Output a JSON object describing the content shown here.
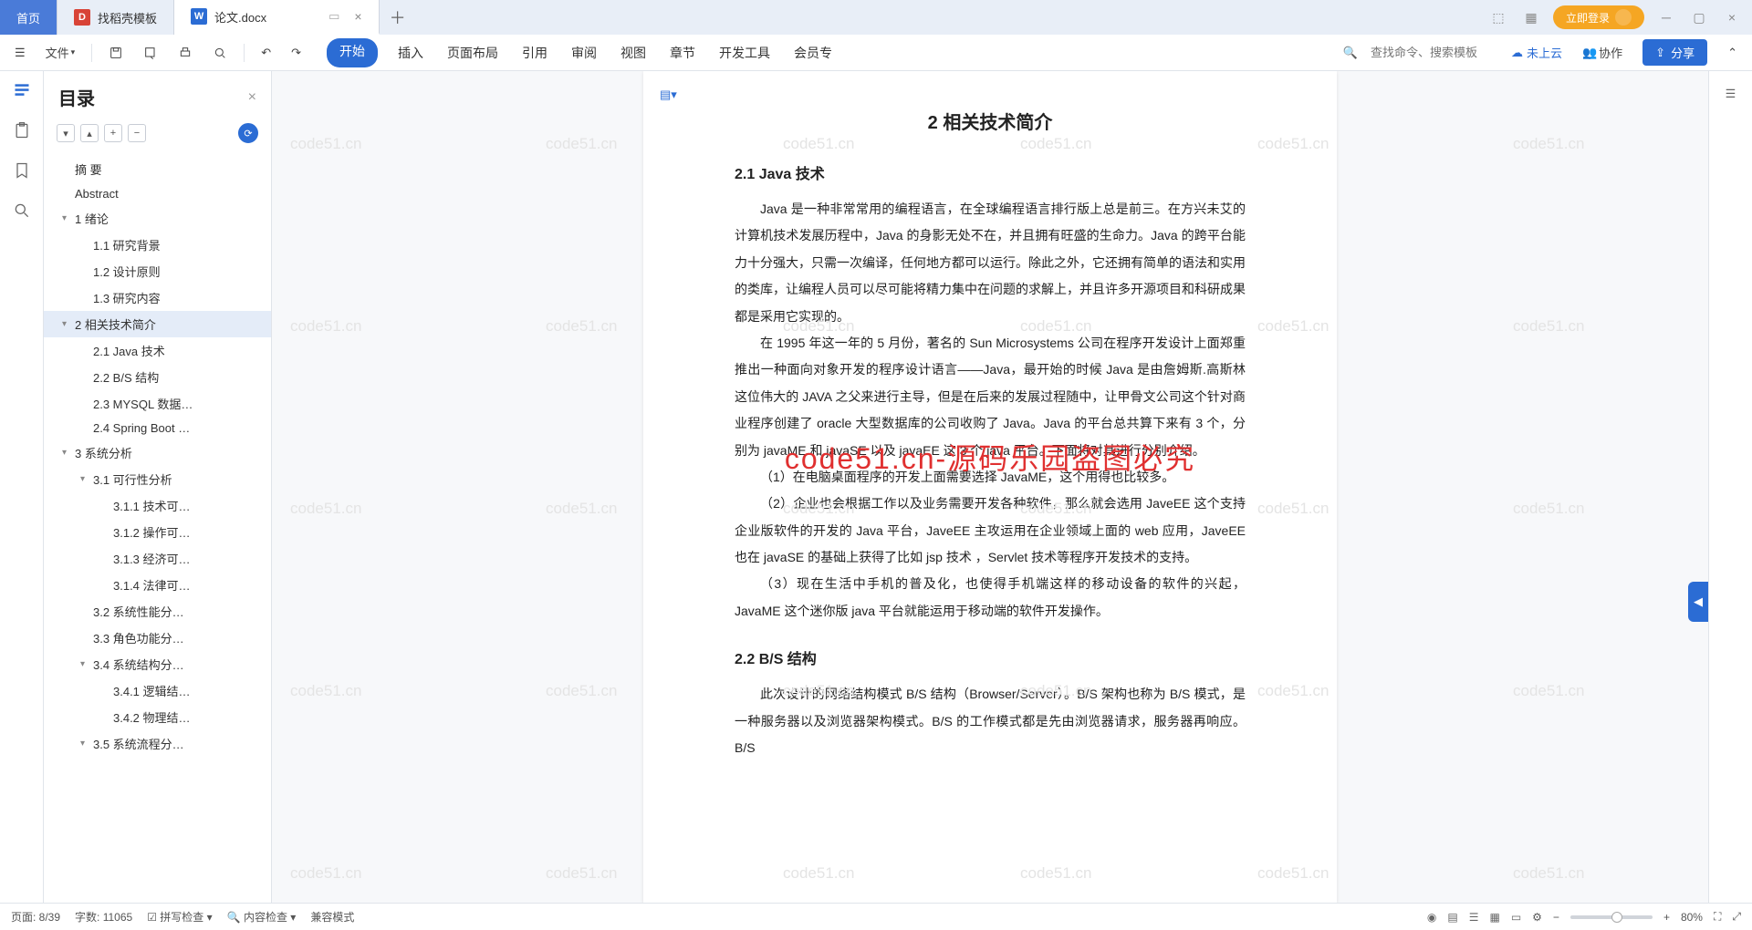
{
  "tabs": {
    "home": "首页",
    "template": "找稻壳模板",
    "doc": "论文.docx"
  },
  "login_label": "立即登录",
  "ribbon": {
    "file": "文件",
    "tabs": [
      "开始",
      "插入",
      "页面布局",
      "引用",
      "审阅",
      "视图",
      "章节",
      "开发工具",
      "会员专"
    ],
    "active_idx": 0,
    "search_placeholder": "查找命令、搜索模板",
    "cloud": "未上云",
    "collab": "协作",
    "share": "分享"
  },
  "outline": {
    "title": "目录",
    "items": [
      {
        "lvl": 1,
        "txt": "摘  要"
      },
      {
        "lvl": 1,
        "txt": "Abstract"
      },
      {
        "lvl": 1,
        "txt": "1  绪论",
        "caret": "v"
      },
      {
        "lvl": 2,
        "txt": "1.1 研究背景"
      },
      {
        "lvl": 2,
        "txt": "1.2 设计原则"
      },
      {
        "lvl": 2,
        "txt": "1.3 研究内容"
      },
      {
        "lvl": 1,
        "txt": "2  相关技术简介",
        "caret": "v",
        "sel": true
      },
      {
        "lvl": 2,
        "txt": "2.1 Java 技术"
      },
      {
        "lvl": 2,
        "txt": "2.2 B/S 结构"
      },
      {
        "lvl": 2,
        "txt": "2.3 MYSQL 数据…"
      },
      {
        "lvl": 2,
        "txt": "2.4 Spring Boot …"
      },
      {
        "lvl": 1,
        "txt": "3  系统分析",
        "caret": "v"
      },
      {
        "lvl": 2,
        "txt": "3.1 可行性分析",
        "caret": "v"
      },
      {
        "lvl": 3,
        "txt": "3.1.1 技术可…"
      },
      {
        "lvl": 3,
        "txt": "3.1.2 操作可…"
      },
      {
        "lvl": 3,
        "txt": "3.1.3 经济可…"
      },
      {
        "lvl": 3,
        "txt": "3.1.4 法律可…"
      },
      {
        "lvl": 2,
        "txt": "3.2 系统性能分…"
      },
      {
        "lvl": 2,
        "txt": "3.3 角色功能分…"
      },
      {
        "lvl": 2,
        "txt": "3.4 系统结构分…",
        "caret": "v"
      },
      {
        "lvl": 3,
        "txt": "3.4.1 逻辑结…"
      },
      {
        "lvl": 3,
        "txt": "3.4.2 物理结…"
      },
      {
        "lvl": 2,
        "txt": "3.5 系统流程分…",
        "caret": "v"
      }
    ]
  },
  "doc": {
    "chapter_title": "2  相关技术简介",
    "h21": "2.1 Java 技术",
    "p1": "Java 是一种非常常用的编程语言，在全球编程语言排行版上总是前三。在方兴未艾的计算机技术发展历程中，Java 的身影无处不在，并且拥有旺盛的生命力。Java 的跨平台能力十分强大，只需一次编译，任何地方都可以运行。除此之外，它还拥有简单的语法和实用的类库，让编程人员可以尽可能将精力集中在问题的求解上，并且许多开源项目和科研成果都是采用它实现的。",
    "p2": "在 1995 年这一年的 5 月份，著名的 Sun Microsystems 公司在程序开发设计上面郑重推出一种面向对象开发的程序设计语言——Java，最开始的时候 Java 是由詹姆斯.高斯林这位伟大的 JAVA 之父来进行主导，但是在后来的发展过程随中，让甲骨文公司这个针对商业程序创建了 oracle 大型数据库的公司收购了 Java。Java 的平台总共算下来有 3 个，分别为 javaME 和 javaSE 以及 javaEE 这 3 个 java 平台。下面将对其进行分别介绍。",
    "p3": "（1）在电脑桌面程序的开发上面需要选择 JavaME，这个用得也比较多。",
    "p4": "（2）企业也会根据工作以及业务需要开发各种软件，那么就会选用 JaveEE 这个支持企业版软件的开发的 Java 平台，JaveEE 主攻运用在企业领域上面的 web 应用，JaveEE 也在 javaSE 的基础上获得了比如 jsp 技术 ，Servlet 技术等程序开发技术的支持。",
    "p5": "（3）现在生活中手机的普及化，也使得手机端这样的移动设备的软件的兴起，JavaME 这个迷你版 java 平台就能运用于移动端的软件开发操作。",
    "h22": "2.2 B/S 结构",
    "p6": "此次设计的网络结构模式 B/S 结构（Browser/Server）。B/S 架构也称为 B/S 模式，是一种服务器以及浏览器架构模式。B/S 的工作模式都是先由浏览器请求，服务器再响应。B/S"
  },
  "watermark_red": "code51.cn-源码乐园盗图必究",
  "watermark_gray": "code51.cn",
  "status": {
    "page": "页面: 8/39",
    "words": "字数: 11065",
    "spell": "拼写检查",
    "content": "内容检查",
    "compat": "兼容模式",
    "zoom": "80%"
  }
}
